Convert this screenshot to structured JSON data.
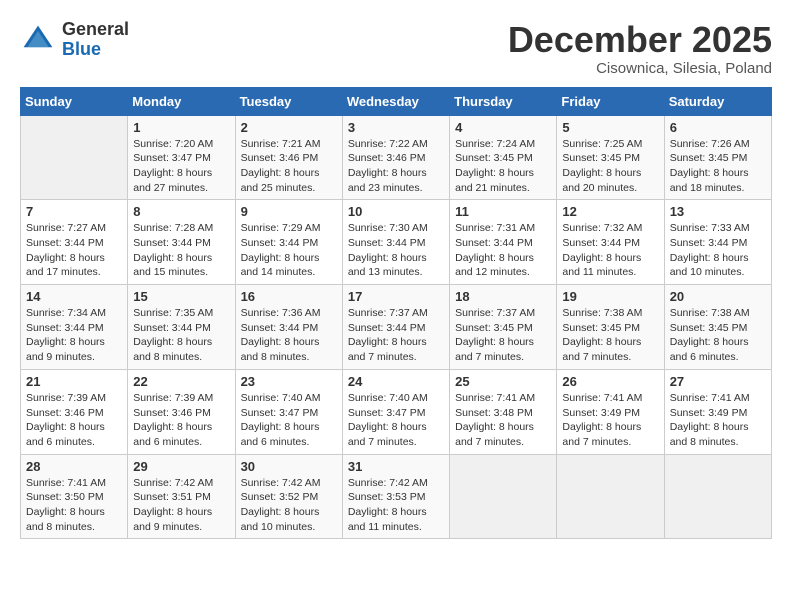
{
  "logo": {
    "general": "General",
    "blue": "Blue"
  },
  "title": "December 2025",
  "location": "Cisownica, Silesia, Poland",
  "days_of_week": [
    "Sunday",
    "Monday",
    "Tuesday",
    "Wednesday",
    "Thursday",
    "Friday",
    "Saturday"
  ],
  "weeks": [
    [
      {
        "day": "",
        "info": ""
      },
      {
        "day": "1",
        "info": "Sunrise: 7:20 AM\nSunset: 3:47 PM\nDaylight: 8 hours\nand 27 minutes."
      },
      {
        "day": "2",
        "info": "Sunrise: 7:21 AM\nSunset: 3:46 PM\nDaylight: 8 hours\nand 25 minutes."
      },
      {
        "day": "3",
        "info": "Sunrise: 7:22 AM\nSunset: 3:46 PM\nDaylight: 8 hours\nand 23 minutes."
      },
      {
        "day": "4",
        "info": "Sunrise: 7:24 AM\nSunset: 3:45 PM\nDaylight: 8 hours\nand 21 minutes."
      },
      {
        "day": "5",
        "info": "Sunrise: 7:25 AM\nSunset: 3:45 PM\nDaylight: 8 hours\nand 20 minutes."
      },
      {
        "day": "6",
        "info": "Sunrise: 7:26 AM\nSunset: 3:45 PM\nDaylight: 8 hours\nand 18 minutes."
      }
    ],
    [
      {
        "day": "7",
        "info": "Sunrise: 7:27 AM\nSunset: 3:44 PM\nDaylight: 8 hours\nand 17 minutes."
      },
      {
        "day": "8",
        "info": "Sunrise: 7:28 AM\nSunset: 3:44 PM\nDaylight: 8 hours\nand 15 minutes."
      },
      {
        "day": "9",
        "info": "Sunrise: 7:29 AM\nSunset: 3:44 PM\nDaylight: 8 hours\nand 14 minutes."
      },
      {
        "day": "10",
        "info": "Sunrise: 7:30 AM\nSunset: 3:44 PM\nDaylight: 8 hours\nand 13 minutes."
      },
      {
        "day": "11",
        "info": "Sunrise: 7:31 AM\nSunset: 3:44 PM\nDaylight: 8 hours\nand 12 minutes."
      },
      {
        "day": "12",
        "info": "Sunrise: 7:32 AM\nSunset: 3:44 PM\nDaylight: 8 hours\nand 11 minutes."
      },
      {
        "day": "13",
        "info": "Sunrise: 7:33 AM\nSunset: 3:44 PM\nDaylight: 8 hours\nand 10 minutes."
      }
    ],
    [
      {
        "day": "14",
        "info": "Sunrise: 7:34 AM\nSunset: 3:44 PM\nDaylight: 8 hours\nand 9 minutes."
      },
      {
        "day": "15",
        "info": "Sunrise: 7:35 AM\nSunset: 3:44 PM\nDaylight: 8 hours\nand 8 minutes."
      },
      {
        "day": "16",
        "info": "Sunrise: 7:36 AM\nSunset: 3:44 PM\nDaylight: 8 hours\nand 8 minutes."
      },
      {
        "day": "17",
        "info": "Sunrise: 7:37 AM\nSunset: 3:44 PM\nDaylight: 8 hours\nand 7 minutes."
      },
      {
        "day": "18",
        "info": "Sunrise: 7:37 AM\nSunset: 3:45 PM\nDaylight: 8 hours\nand 7 minutes."
      },
      {
        "day": "19",
        "info": "Sunrise: 7:38 AM\nSunset: 3:45 PM\nDaylight: 8 hours\nand 7 minutes."
      },
      {
        "day": "20",
        "info": "Sunrise: 7:38 AM\nSunset: 3:45 PM\nDaylight: 8 hours\nand 6 minutes."
      }
    ],
    [
      {
        "day": "21",
        "info": "Sunrise: 7:39 AM\nSunset: 3:46 PM\nDaylight: 8 hours\nand 6 minutes."
      },
      {
        "day": "22",
        "info": "Sunrise: 7:39 AM\nSunset: 3:46 PM\nDaylight: 8 hours\nand 6 minutes."
      },
      {
        "day": "23",
        "info": "Sunrise: 7:40 AM\nSunset: 3:47 PM\nDaylight: 8 hours\nand 6 minutes."
      },
      {
        "day": "24",
        "info": "Sunrise: 7:40 AM\nSunset: 3:47 PM\nDaylight: 8 hours\nand 7 minutes."
      },
      {
        "day": "25",
        "info": "Sunrise: 7:41 AM\nSunset: 3:48 PM\nDaylight: 8 hours\nand 7 minutes."
      },
      {
        "day": "26",
        "info": "Sunrise: 7:41 AM\nSunset: 3:49 PM\nDaylight: 8 hours\nand 7 minutes."
      },
      {
        "day": "27",
        "info": "Sunrise: 7:41 AM\nSunset: 3:49 PM\nDaylight: 8 hours\nand 8 minutes."
      }
    ],
    [
      {
        "day": "28",
        "info": "Sunrise: 7:41 AM\nSunset: 3:50 PM\nDaylight: 8 hours\nand 8 minutes."
      },
      {
        "day": "29",
        "info": "Sunrise: 7:42 AM\nSunset: 3:51 PM\nDaylight: 8 hours\nand 9 minutes."
      },
      {
        "day": "30",
        "info": "Sunrise: 7:42 AM\nSunset: 3:52 PM\nDaylight: 8 hours\nand 10 minutes."
      },
      {
        "day": "31",
        "info": "Sunrise: 7:42 AM\nSunset: 3:53 PM\nDaylight: 8 hours\nand 11 minutes."
      },
      {
        "day": "",
        "info": ""
      },
      {
        "day": "",
        "info": ""
      },
      {
        "day": "",
        "info": ""
      }
    ]
  ]
}
